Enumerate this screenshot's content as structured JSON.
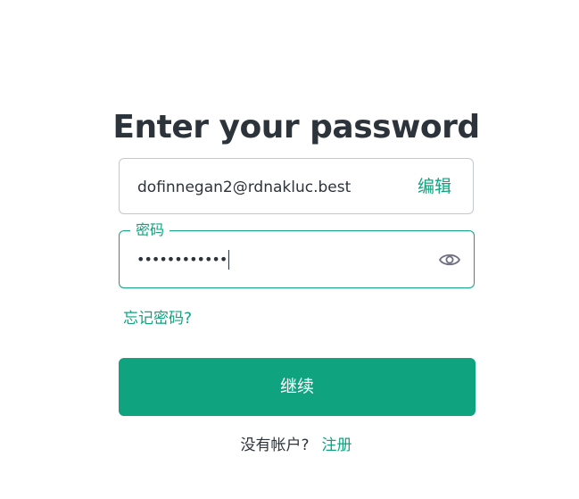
{
  "page": {
    "title": "Enter your password"
  },
  "email": {
    "value": "dofinnegan2@rdnakluc.best",
    "edit_label": "编辑"
  },
  "password": {
    "label": "密码",
    "masked_value": "••••••••••••",
    "toggle_icon": "eye-icon"
  },
  "links": {
    "forgot_password": "忘记密码?"
  },
  "actions": {
    "continue_label": "继续"
  },
  "signup": {
    "prompt": "没有帐户?",
    "link_label": "注册"
  },
  "colors": {
    "accent": "#10a37f",
    "text": "#2d333a",
    "border": "#c2c8d0"
  }
}
